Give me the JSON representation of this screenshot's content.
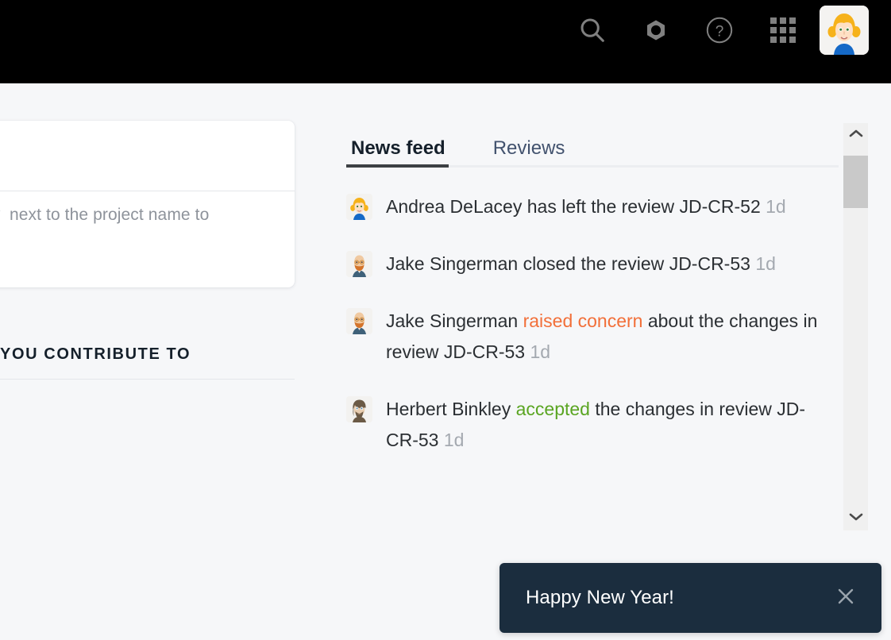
{
  "topbar": {
    "background_color": "#000000",
    "icon_color": "#808080",
    "actions": [
      {
        "name": "search-icon",
        "label": "Search"
      },
      {
        "name": "settings-icon",
        "label": "Settings"
      },
      {
        "name": "help-icon",
        "label": "Help"
      },
      {
        "name": "apps-grid-icon",
        "label": "Apps"
      }
    ],
    "profile": {
      "name": "profile-avatar",
      "label": "Your profile"
    }
  },
  "left_panel": {
    "promo_card": {
      "icon": "star-icon",
      "text": "next to the project name to"
    },
    "section": {
      "heading": "YOU CONTRIBUTE TO"
    }
  },
  "feed_panel": {
    "tabs": [
      {
        "label": "News feed",
        "active": true
      },
      {
        "label": "Reviews",
        "active": false
      }
    ],
    "items": [
      {
        "avatar": "avatar-andrea-delacey",
        "actor": "Andrea DeLacey",
        "action": " has left the review ",
        "highlight": "",
        "highlight_kind": "none",
        "tail": "JD-CR-52",
        "time": "1d"
      },
      {
        "avatar": "avatar-jake-singerman",
        "actor": "Jake Singerman",
        "action": " closed the review ",
        "highlight": "",
        "highlight_kind": "none",
        "tail": "JD-CR-53",
        "time": "1d"
      },
      {
        "avatar": "avatar-jake-singerman",
        "actor": "Jake Singerman",
        "action": " ",
        "highlight": "raised concern",
        "highlight_kind": "warn",
        "tail": " about the changes in review JD-CR-53",
        "time": "1d"
      },
      {
        "avatar": "avatar-herbert-binkley",
        "actor": "Herbert Binkley",
        "action": " ",
        "highlight": "accepted",
        "highlight_kind": "ok",
        "tail": " the changes in review JD-CR-53",
        "time": "1d"
      }
    ],
    "colors": {
      "warn": "#f26f39",
      "ok": "#5aa522",
      "time": "#a4a9b0",
      "active_tab_underline": "#3d4144"
    }
  },
  "scrollbar": {
    "up_arrow": "chevron-up-icon",
    "down_arrow": "chevron-down-icon",
    "thumb_color": "#c9c9c9",
    "track_color": "#f0f0f0"
  },
  "toast": {
    "message": "Happy New Year!",
    "close_label": "Dismiss",
    "background_color": "#1b2d3e"
  }
}
